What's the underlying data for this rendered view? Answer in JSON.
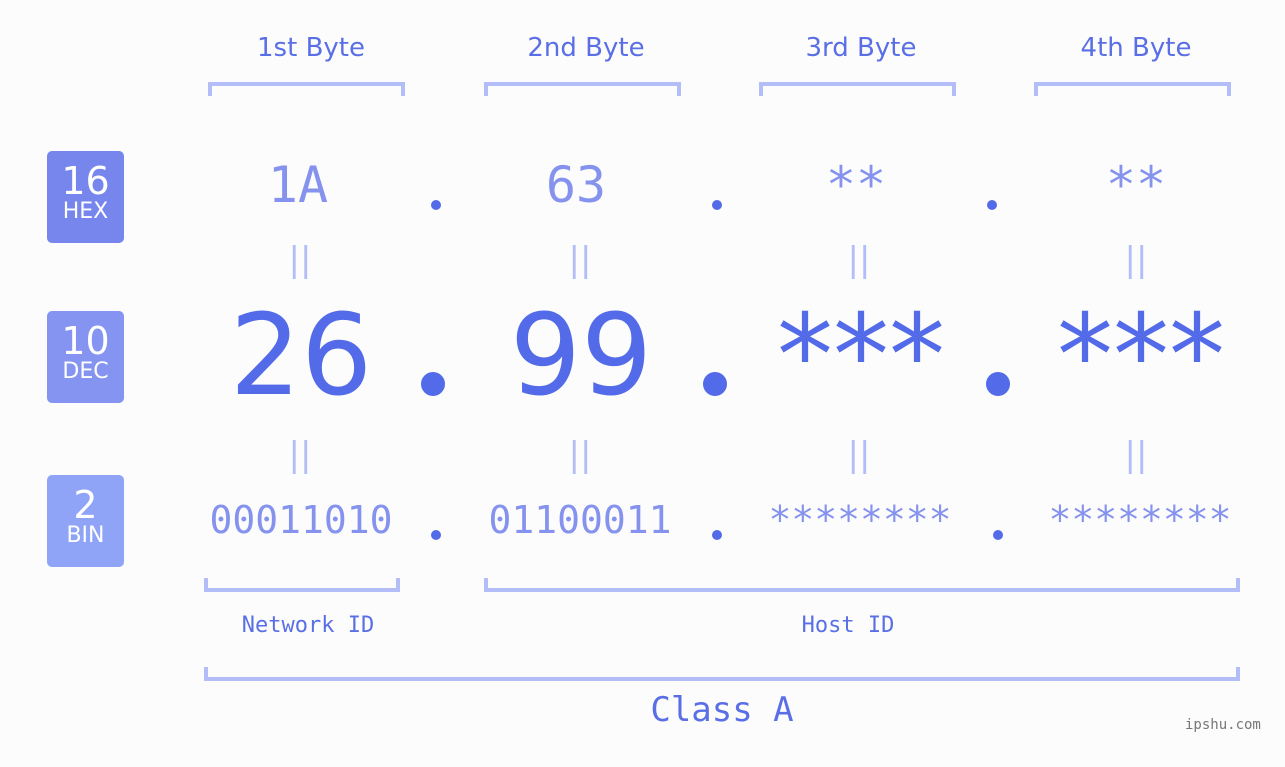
{
  "byte_headers": [
    "1st Byte",
    "2nd Byte",
    "3rd Byte",
    "4th Byte"
  ],
  "rows": {
    "hex": {
      "base": "16",
      "label": "HEX",
      "values": [
        "1A",
        "63",
        "**",
        "**"
      ],
      "badge_color": "#7686ec"
    },
    "dec": {
      "base": "10",
      "label": "DEC",
      "values": [
        "26",
        "99",
        "***",
        "***"
      ],
      "badge_color": "#8594f0"
    },
    "bin": {
      "base": "2",
      "label": "BIN",
      "values": [
        "00011010",
        "01100011",
        "********",
        "********"
      ],
      "badge_color": "#90a4f7"
    }
  },
  "separator": ".",
  "equals_glyph": "||",
  "segments": {
    "network": "Network ID",
    "host": "Host ID"
  },
  "ip_class": "Class A",
  "watermark": "ipshu.com",
  "colors": {
    "primary": "#546be9",
    "light": "#8592ee",
    "bracket": "#b3bdf7",
    "background": "#fbfcfb"
  }
}
